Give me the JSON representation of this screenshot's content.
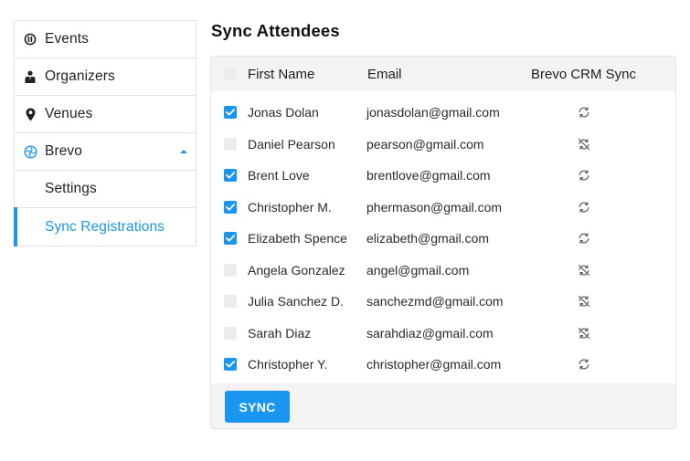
{
  "sidebar": {
    "items": [
      {
        "label": "Events",
        "icon": "events-icon"
      },
      {
        "label": "Organizers",
        "icon": "organizer-person-icon"
      },
      {
        "label": "Venues",
        "icon": "map-pin-icon"
      },
      {
        "label": "Brevo",
        "icon": "brevo-logo-icon",
        "expanded": true
      },
      {
        "label": "Settings"
      },
      {
        "label": "Sync Registrations",
        "active": true
      }
    ]
  },
  "main": {
    "title": "Sync Attendees",
    "table": {
      "headers": {
        "first_name": "First Name",
        "email": "Email",
        "sync": "Brevo CRM Sync"
      },
      "header_checked": false,
      "rows": [
        {
          "name": "Jonas Dolan",
          "email": "jonasdolan@gmail.com",
          "checked": true,
          "synced": true
        },
        {
          "name": "Daniel Pearson",
          "email": "pearson@gmail.com",
          "checked": false,
          "synced": false
        },
        {
          "name": "Brent Love",
          "email": "brentlove@gmail.com",
          "checked": true,
          "synced": true
        },
        {
          "name": "Christopher M.",
          "email": "phermason@gmail.com",
          "checked": true,
          "synced": true
        },
        {
          "name": "Elizabeth Spence",
          "email": "elizabeth@gmail.com",
          "checked": true,
          "synced": true
        },
        {
          "name": "Angela Gonzalez",
          "email": "angel@gmail.com",
          "checked": false,
          "synced": false
        },
        {
          "name": "Julia Sanchez D.",
          "email": "sanchezmd@gmail.com",
          "checked": false,
          "synced": false
        },
        {
          "name": "Sarah Diaz",
          "email": "sarahdiaz@gmail.com",
          "checked": false,
          "synced": false
        },
        {
          "name": "Christopher Y.",
          "email": "christopher@gmail.com",
          "checked": true,
          "synced": true
        }
      ]
    },
    "sync_button": "SYNC"
  },
  "colors": {
    "accent": "#1a96f0",
    "checkbox_unchecked": "#ececec",
    "panel_bg": "#f3f3f3",
    "sync_icon": "#666666"
  }
}
